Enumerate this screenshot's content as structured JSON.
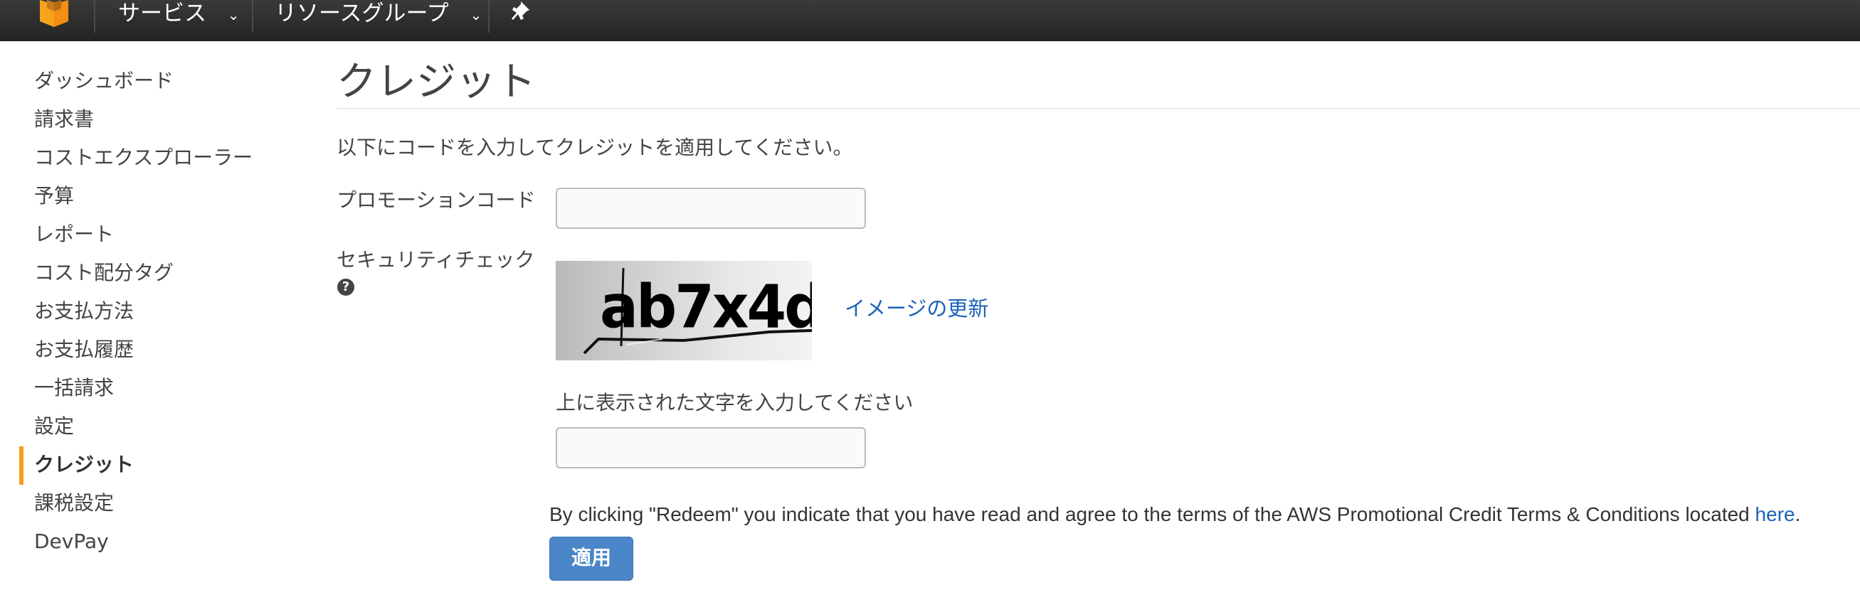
{
  "topnav": {
    "services_label": "サービス",
    "resource_groups_label": "リソースグループ"
  },
  "sidebar": {
    "items": [
      {
        "label": "ダッシュボード"
      },
      {
        "label": "請求書"
      },
      {
        "label": "コストエクスプローラー"
      },
      {
        "label": "予算"
      },
      {
        "label": "レポート"
      },
      {
        "label": "コスト配分タグ"
      },
      {
        "label": "お支払方法"
      },
      {
        "label": "お支払履歴"
      },
      {
        "label": "一括請求"
      },
      {
        "label": "設定"
      },
      {
        "label": "クレジット",
        "active": true
      },
      {
        "label": "課税設定"
      },
      {
        "label": "DevPay"
      }
    ]
  },
  "main": {
    "title": "クレジット",
    "intro": "以下にコードを入力してクレジットを適用してください。",
    "promo_label": "プロモーションコード",
    "promo_value": "",
    "security_label": "セキュリティチェック",
    "captcha_text": "ab7x4d",
    "refresh_label": "イメージの更新",
    "captcha_prompt": "上に表示された文字を入力してください",
    "captcha_value": "",
    "terms_text": "By clicking \"Redeem\" you indicate that you have read and agree to the terms of the AWS Promotional Credit Terms & Conditions located ",
    "terms_link": "here",
    "terms_end": ".",
    "apply_label": "適用"
  },
  "colors": {
    "accent": "#f79c1e",
    "link": "#1a63b8",
    "button": "#4a86c8",
    "topbar": "#232323"
  }
}
